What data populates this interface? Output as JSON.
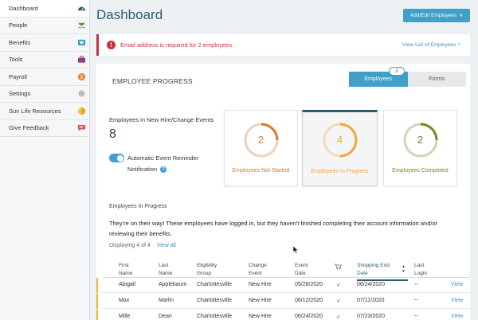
{
  "sidebar": {
    "items": [
      {
        "label": "Dashboard",
        "icon": "dashboard-gauge-icon",
        "active": true
      },
      {
        "label": "People",
        "icon": "people-icon",
        "active": false
      },
      {
        "label": "Benefits",
        "icon": "benefits-heart-icon",
        "active": false
      },
      {
        "label": "Tools",
        "icon": "toolbox-icon",
        "active": false
      },
      {
        "label": "Payroll",
        "icon": "payroll-coin-icon",
        "active": false
      },
      {
        "label": "Settings",
        "icon": "gear-icon",
        "active": false
      },
      {
        "label": "Sun Life Resources",
        "icon": "sun-life-icon",
        "active": false
      },
      {
        "label": "Give Feedback",
        "icon": "feedback-chat-icon",
        "active": false
      }
    ]
  },
  "header": {
    "title": "Dashboard",
    "add_edit_label": "Add/Edit Employees"
  },
  "alert": {
    "message": "Email address is required for 2 employees.",
    "link_label": "View List of Employees"
  },
  "progress": {
    "title": "EMPLOYEE PROGRESS",
    "tabs": [
      {
        "label": "Employees",
        "badge": "2",
        "active": true
      },
      {
        "label": "Forms",
        "active": false
      }
    ],
    "new_hire_label": "Employees in New Hire/Change Events",
    "new_hire_count": "8",
    "auto_reminder_line1": "Automatic Event Reminder",
    "auto_reminder_line2": "Notification",
    "tiles": [
      {
        "count": "2",
        "label": "Employees Not Started",
        "color": "#d9792b",
        "fraction": 0.25
      },
      {
        "count": "4",
        "label": "Employees In Progress",
        "color": "#f0a93a",
        "fraction": 0.5,
        "selected": true
      },
      {
        "count": "2",
        "label": "Employees Completed",
        "color": "#6b8e23",
        "fraction": 0.25
      }
    ]
  },
  "in_progress": {
    "section_label": "Employees In Progress",
    "description": "They're on their way! These employees have logged in, but they haven't finished completing their account information and/or reviewing their benefits.",
    "displaying": "Displaying 4 of 4",
    "view_all": "View all"
  },
  "table": {
    "headers": {
      "first_name_1": "First",
      "first_name_2": "Name",
      "last_name_1": "Last",
      "last_name_2": "Name",
      "eligibility_1": "Eligibility",
      "eligibility_2": "Group",
      "change_event_1": "Change",
      "change_event_2": "Event",
      "event_date_1": "Event",
      "event_date_2": "Date",
      "shopping_end_1": "Shopping End",
      "shopping_end_2": "Date",
      "last_login_1": "Last",
      "last_login_2": "Login"
    },
    "rows": [
      {
        "first": "Abigail",
        "last": "Applebaum",
        "group": "Charlottesville",
        "event": "New Hire",
        "event_date": "05/26/2020",
        "shopping_end": "06/24/2020",
        "last_login": "--",
        "action": "View"
      },
      {
        "first": "Max",
        "last": "Marlin",
        "group": "Charlottesville",
        "event": "New Hire",
        "event_date": "06/12/2020",
        "shopping_end": "07/11/2020",
        "last_login": "--",
        "action": "View"
      },
      {
        "first": "Mille",
        "last": "Dean",
        "group": "Charlottesville",
        "event": "New Hire",
        "event_date": "06/24/2020",
        "shopping_end": "07/23/2020",
        "last_login": "--",
        "action": "View"
      }
    ]
  },
  "colors": {
    "accent": "#3fa0c9",
    "title": "#2c5b73",
    "alert": "#c7323f"
  }
}
